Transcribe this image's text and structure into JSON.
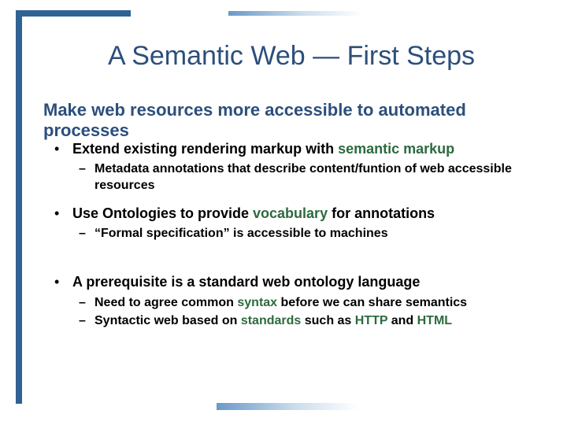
{
  "title": "A Semantic Web — First Steps",
  "subtitle": "Make web resources more accessible to automated processes",
  "bullets": [
    {
      "l1_pre": "Extend existing rendering markup with ",
      "hl": "semantic markup",
      "l1_post": "",
      "subs": [
        {
          "pre": "Metadata annotations that describe content/funtion of web accessible resources",
          "hl": "",
          "post": ""
        }
      ]
    },
    {
      "l1_pre": "Use Ontologies to provide ",
      "hl": "vocabulary",
      "l1_post": " for annotations",
      "subs": [
        {
          "pre": "“Formal specification” is accessible to machines",
          "hl": "",
          "post": ""
        }
      ]
    },
    {
      "gapBefore": true,
      "l1_pre": "A prerequisite is a standard web ontology language",
      "hl": "",
      "l1_post": "",
      "subs": [
        {
          "pre": "Need to agree common ",
          "hl": "syntax",
          "post": " before we can share semantics"
        },
        {
          "pre": "Syntactic web based on ",
          "hl": "standards",
          "post": " such as ",
          "hl2": "HTTP",
          "post2": " and ",
          "hl3": "HTML",
          "post3": ""
        }
      ]
    }
  ]
}
